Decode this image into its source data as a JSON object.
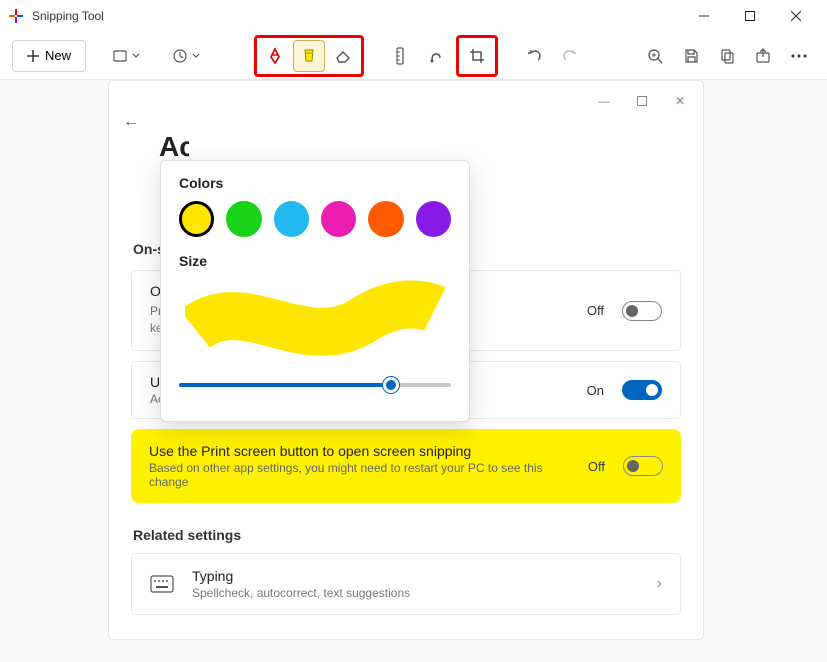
{
  "app": {
    "title": "Snipping Tool"
  },
  "toolbar": {
    "new_label": "New"
  },
  "popup": {
    "colors_label": "Colors",
    "size_label": "Size",
    "swatches": [
      "#ffe600",
      "#18d118",
      "#22b8f0",
      "#ec1db1",
      "#ff5a00",
      "#8a1ae6"
    ]
  },
  "settings": {
    "page_title": "Accessibility",
    "section_onscreen": "On-screen keyboard, access keys, and Print screen",
    "row1": {
      "title": "On-screen keyboard",
      "sub": "Press the Windows logo key + Ctrl + O to turn on the on-screen keyboard",
      "state": "Off"
    },
    "row2": {
      "title": "Underline access keys",
      "sub": "Access keys will be underlined even when not holding Alt",
      "state": "On"
    },
    "row3": {
      "title": "Use the Print screen button to open screen snipping",
      "sub": "Based on other app settings, you might need to restart your PC to see this change",
      "state": "Off"
    },
    "related_label": "Related settings",
    "typing": {
      "title": "Typing",
      "sub": "Spellcheck, autocorrect, text suggestions"
    }
  }
}
